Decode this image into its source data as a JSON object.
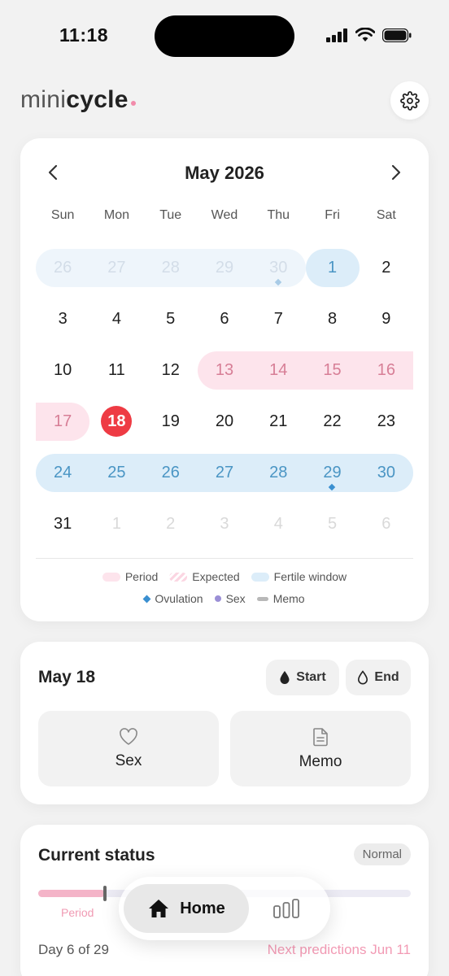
{
  "status_bar": {
    "time": "11:18"
  },
  "header": {
    "logo_part1": "mini",
    "logo_part2": "cycle"
  },
  "calendar": {
    "title": "May 2026",
    "weekdays": [
      "Sun",
      "Mon",
      "Tue",
      "Wed",
      "Thu",
      "Fri",
      "Sat"
    ],
    "weeks": [
      [
        {
          "d": "26",
          "type": "prev-fert"
        },
        {
          "d": "27",
          "type": "prev-fert"
        },
        {
          "d": "28",
          "type": "prev-fert"
        },
        {
          "d": "29",
          "type": "prev-fert"
        },
        {
          "d": "30",
          "type": "prev-fert",
          "ovulation": true
        },
        {
          "d": "1",
          "type": "fertile"
        },
        {
          "d": "2",
          "type": "normal"
        }
      ],
      [
        {
          "d": "3",
          "type": "normal"
        },
        {
          "d": "4",
          "type": "normal"
        },
        {
          "d": "5",
          "type": "normal"
        },
        {
          "d": "6",
          "type": "normal"
        },
        {
          "d": "7",
          "type": "normal"
        },
        {
          "d": "8",
          "type": "normal"
        },
        {
          "d": "9",
          "type": "normal"
        }
      ],
      [
        {
          "d": "10",
          "type": "normal"
        },
        {
          "d": "11",
          "type": "normal"
        },
        {
          "d": "12",
          "type": "normal"
        },
        {
          "d": "13",
          "type": "period"
        },
        {
          "d": "14",
          "type": "period"
        },
        {
          "d": "15",
          "type": "period"
        },
        {
          "d": "16",
          "type": "period"
        }
      ],
      [
        {
          "d": "17",
          "type": "period"
        },
        {
          "d": "18",
          "type": "today"
        },
        {
          "d": "19",
          "type": "normal"
        },
        {
          "d": "20",
          "type": "normal"
        },
        {
          "d": "21",
          "type": "normal"
        },
        {
          "d": "22",
          "type": "normal"
        },
        {
          "d": "23",
          "type": "normal"
        }
      ],
      [
        {
          "d": "24",
          "type": "fertile"
        },
        {
          "d": "25",
          "type": "fertile"
        },
        {
          "d": "26",
          "type": "fertile"
        },
        {
          "d": "27",
          "type": "fertile"
        },
        {
          "d": "28",
          "type": "fertile"
        },
        {
          "d": "29",
          "type": "fertile",
          "ovulation": true
        },
        {
          "d": "30",
          "type": "fertile"
        }
      ],
      [
        {
          "d": "31",
          "type": "normal"
        },
        {
          "d": "1",
          "type": "other"
        },
        {
          "d": "2",
          "type": "other"
        },
        {
          "d": "3",
          "type": "other"
        },
        {
          "d": "4",
          "type": "other"
        },
        {
          "d": "5",
          "type": "other"
        },
        {
          "d": "6",
          "type": "other"
        }
      ]
    ],
    "legend": {
      "period": "Period",
      "expected": "Expected",
      "fertile": "Fertile window",
      "ovulation": "Ovulation",
      "sex": "Sex",
      "memo": "Memo"
    }
  },
  "day_panel": {
    "date": "May 18",
    "start_label": "Start",
    "end_label": "End",
    "sex_label": "Sex",
    "memo_label": "Memo"
  },
  "status": {
    "title": "Current status",
    "badge": "Normal",
    "phase_label": "Period",
    "day_of": "Day 6 of 29",
    "next_predictions": "Next predictions Jun 11",
    "progress_fraction": 0.18
  },
  "tabbar": {
    "home_label": "Home"
  },
  "colors": {
    "accent": "#ee3b44",
    "period": "#fde4ec",
    "fertile": "#dcedf9",
    "ovulation": "#3a8fd0",
    "sex": "#9b8fd6",
    "memo": "#b8b8b8"
  }
}
